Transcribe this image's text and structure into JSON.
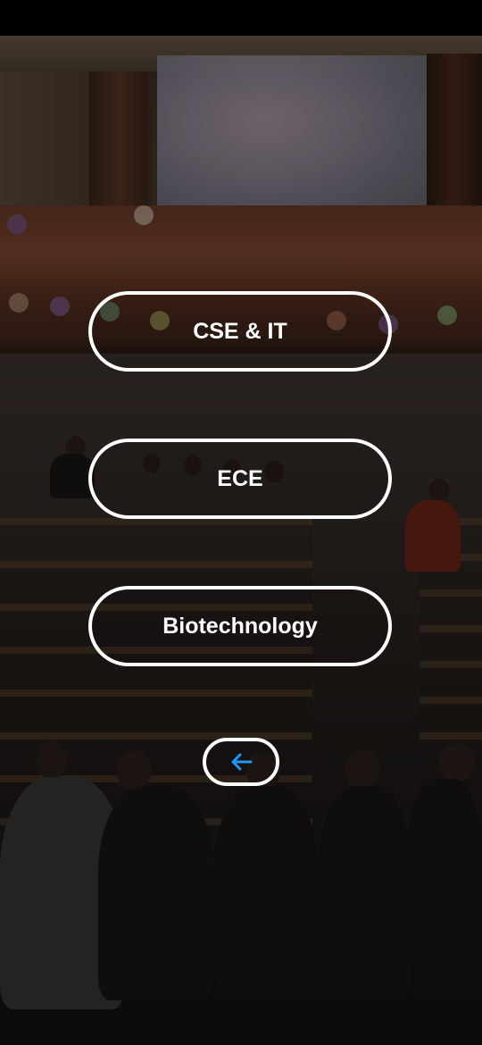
{
  "menu": {
    "buttons": [
      {
        "label": "CSE & IT"
      },
      {
        "label": "ECE"
      },
      {
        "label": "Biotechnology"
      }
    ],
    "back_icon": "arrow-left-icon"
  },
  "colors": {
    "button_border": "#ffffff",
    "button_text": "#ffffff",
    "back_arrow": "#2196f3"
  },
  "background": {
    "image": "auditorium-photo"
  }
}
